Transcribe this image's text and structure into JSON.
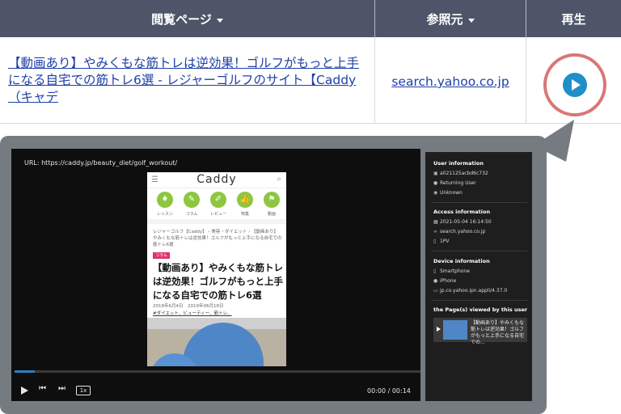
{
  "table": {
    "headers": {
      "page": "閲覧ページ",
      "referrer": "参照元",
      "play": "再生"
    },
    "row": {
      "page_title": "【動画あり】やみくもな筋トレは逆効果！ゴルフがもっと上手になる自宅での筋トレ6選 - レジャーゴルフのサイト【Caddy（キャデ",
      "referrer": "search.yahoo.co.jp"
    }
  },
  "player": {
    "url": "URL: https://caddy.jp/beauty_diet/golf_workout/",
    "progress_percent": 5,
    "speed": "1x",
    "time": "00:00 / 00:14",
    "page": {
      "logo": "Caddy",
      "nav": [
        "レッスン",
        "コラム",
        "レビュー",
        "特集",
        "動画"
      ],
      "breadcrumb": "レジャーゴルフ【Caddy】 › 美容・ダイエット › 【動画あり】やみくもな筋トレは逆効果！ゴルフがもっと上手になる自宅での筋トレ6選",
      "tag": "コラム",
      "title": "【動画あり】やみくもな筋トレは逆効果！ゴルフがもっと上手になる自宅での筋トレ6選",
      "date": "2018年6月4日　2019年06月18日",
      "categories": "#ダイエット、ビューティー、筋トレ、"
    }
  },
  "side": {
    "user_heading": "User information",
    "user_id": "a021125acbd6c732",
    "user_type": "Returning User",
    "user_location": "Unknown",
    "access_heading": "Access information",
    "access_time": "2021-05-04 16:14:50",
    "access_ref": "search.yahoo.co.jp",
    "access_pv": "1PV",
    "device_heading": "Device information",
    "device_type": "Smartphone",
    "device_model": "iPhone",
    "device_app": "jp.co.yahoo.ipn.appli/4.37.0",
    "pages_heading": "the Page(s) viewed by this user",
    "page_card": "【動画あり】やみくもな筋トレは逆効果！ゴルフがもっと上手になる自宅での..."
  }
}
